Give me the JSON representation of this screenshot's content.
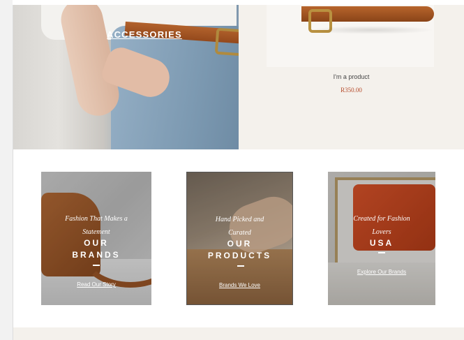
{
  "hero": {
    "label": "ACCESSORIES"
  },
  "product": {
    "name": "I'm a product",
    "price": "R350.00"
  },
  "tiles": [
    {
      "tagline_line1": "Fashion That Makes a",
      "tagline_line2": "Statement",
      "heading_line1": "OUR",
      "heading_line2": "BRANDS",
      "link": "Read Our Story"
    },
    {
      "tagline_line1": "Hand Picked and",
      "tagline_line2": "Curated",
      "heading_line1": "OUR",
      "heading_line2": "PRODUCTS",
      "link": "Brands We Love"
    },
    {
      "tagline_line1": "Created for Fashion",
      "tagline_line2": "Lovers",
      "heading_line1": "USA",
      "heading_line2": "",
      "link": "Explore Our Brands"
    }
  ],
  "colors": {
    "price": "#b54a2a",
    "section_background": "#f4f1ec"
  }
}
